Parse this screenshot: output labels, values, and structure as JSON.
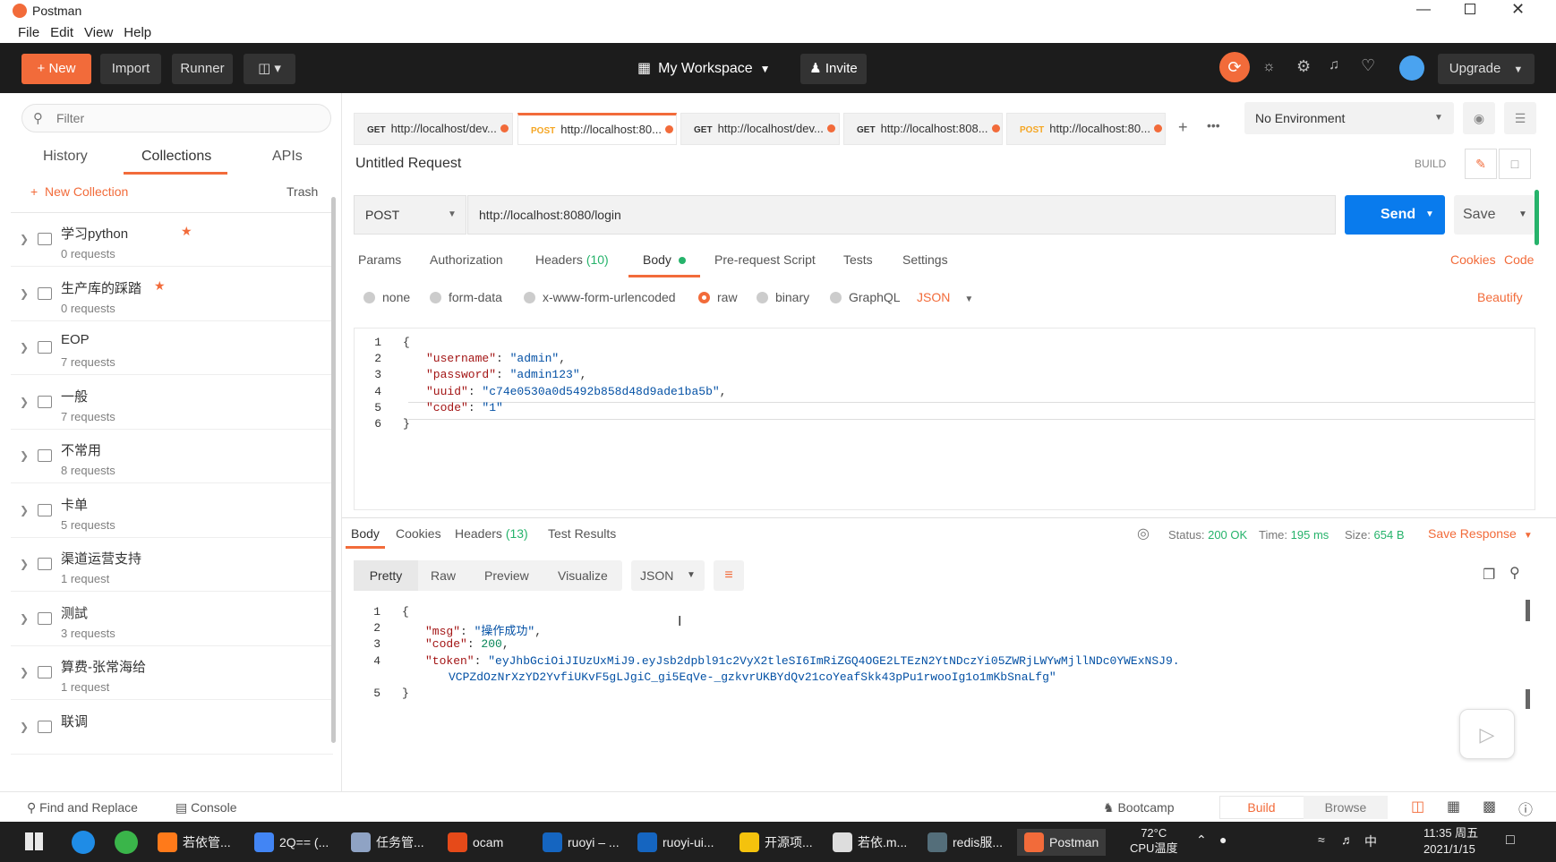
{
  "window": {
    "title": "Postman"
  },
  "menu": [
    "File",
    "Edit",
    "View",
    "Help"
  ],
  "header": {
    "new": "New",
    "import": "Import",
    "runner": "Runner",
    "workspace": "My Workspace",
    "invite": "Invite",
    "upgrade": "Upgrade"
  },
  "sidebar": {
    "filter_placeholder": "Filter",
    "tabs": [
      "History",
      "Collections",
      "APIs"
    ],
    "new_collection": "New Collection",
    "trash": "Trash",
    "collections": [
      {
        "name": "学习python",
        "count": "0 requests",
        "star": true
      },
      {
        "name": "生产库的踩踏",
        "count": "0 requests",
        "star": true
      },
      {
        "name": "EOP",
        "count": "7 requests",
        "star": false
      },
      {
        "name": "一般",
        "count": "7 requests",
        "star": false
      },
      {
        "name": "不常用",
        "count": "8 requests",
        "star": false
      },
      {
        "name": "卡单",
        "count": "5 requests",
        "star": false
      },
      {
        "name": "渠道运营支持",
        "count": "1 request",
        "star": false
      },
      {
        "name": "测試",
        "count": "3 requests",
        "star": false
      },
      {
        "name": "算费-张常海给",
        "count": "1 request",
        "star": false
      },
      {
        "name": "联调",
        "count": "",
        "star": false
      }
    ]
  },
  "tabs": [
    {
      "method": "GET",
      "url": "http://localhost/dev..."
    },
    {
      "method": "POST",
      "url": "http://localhost:80..."
    },
    {
      "method": "GET",
      "url": "http://localhost/dev..."
    },
    {
      "method": "GET",
      "url": "http://localhost:808..."
    },
    {
      "method": "POST",
      "url": "http://localhost:80..."
    }
  ],
  "environment": "No Environment",
  "request": {
    "name": "Untitled Request",
    "build": "BUILD",
    "method": "POST",
    "url": "http://localhost:8080/login",
    "send": "Send",
    "save": "Save",
    "subtabs": [
      "Params",
      "Authorization",
      "Headers",
      "(10)",
      "Body",
      "Pre-request Script",
      "Tests",
      "Settings"
    ],
    "cookies": "Cookies",
    "code": "Code",
    "body_types": [
      "none",
      "form-data",
      "x-www-form-urlencoded",
      "raw",
      "binary",
      "GraphQL"
    ],
    "format": "JSON",
    "beautify": "Beautify",
    "body_lines": [
      {
        "n": "1",
        "text": "{"
      },
      {
        "n": "2",
        "key": "\"username\"",
        "val": "\"admin\"",
        "tail": ","
      },
      {
        "n": "3",
        "key": "\"password\"",
        "val": "\"admin123\"",
        "tail": ","
      },
      {
        "n": "4",
        "key": "\"uuid\"",
        "val": "\"c74e0530a0d5492b858d48d9ade1ba5b\"",
        "tail": ","
      },
      {
        "n": "5",
        "key": "\"code\"",
        "val": "\"1\"",
        "tail": ""
      },
      {
        "n": "6",
        "text": "}"
      }
    ]
  },
  "response": {
    "tabs": [
      "Body",
      "Cookies",
      "Headers",
      "(13)",
      "Test Results"
    ],
    "status_label": "Status:",
    "status": "200 OK",
    "time_label": "Time:",
    "time": "195 ms",
    "size_label": "Size:",
    "size": "654 B",
    "save_response": "Save Response",
    "views": [
      "Pretty",
      "Raw",
      "Preview",
      "Visualize"
    ],
    "format": "JSON",
    "lines": [
      {
        "n": "1",
        "text": "{"
      },
      {
        "n": "2",
        "key": "\"msg\"",
        "val": "\"操作成功\"",
        "tail": ","
      },
      {
        "n": "3",
        "key": "\"code\"",
        "val": "200",
        "tail": ","
      },
      {
        "n": "4",
        "key": "\"token\"",
        "val": "\"eyJhbGciOiJIUzUxMiJ9.eyJsb2dpbl91c2VyX2tleSI6ImRiZGQ4OGE2LTEzN2YtNDczYi05ZWRjLWYwMjllNDc0YWExNSJ9.",
        "tail": ""
      },
      {
        "n": "",
        "cont": "VCPZdOzNrXzYD2YvfiUKvF5gLJgiC_gi5EqVe-_gzkvrUKBYdQv21coYeafSkk43pPu1rwooIg1o1mKbSnaLfg\""
      },
      {
        "n": "5",
        "text": "}"
      }
    ]
  },
  "footer": {
    "find": "Find and Replace",
    "console": "Console",
    "bootcamp": "Bootcamp",
    "build": "Build",
    "browse": "Browse"
  },
  "taskbar": {
    "items": [
      "若依管...",
      "2Q== (...",
      "任务管...",
      "ocam",
      "ruoyi – ...",
      "ruoyi-ui...",
      "开源项...",
      "若依.m...",
      "redis服...",
      "Postman"
    ],
    "temp": "72°C",
    "temp_label": "CPU温度",
    "ime": "中",
    "time": "11:35 周五",
    "date": "2021/1/15"
  },
  "colors": {
    "accent": "#f26b3a",
    "send": "#097bed",
    "header": "#1c1c1c"
  }
}
